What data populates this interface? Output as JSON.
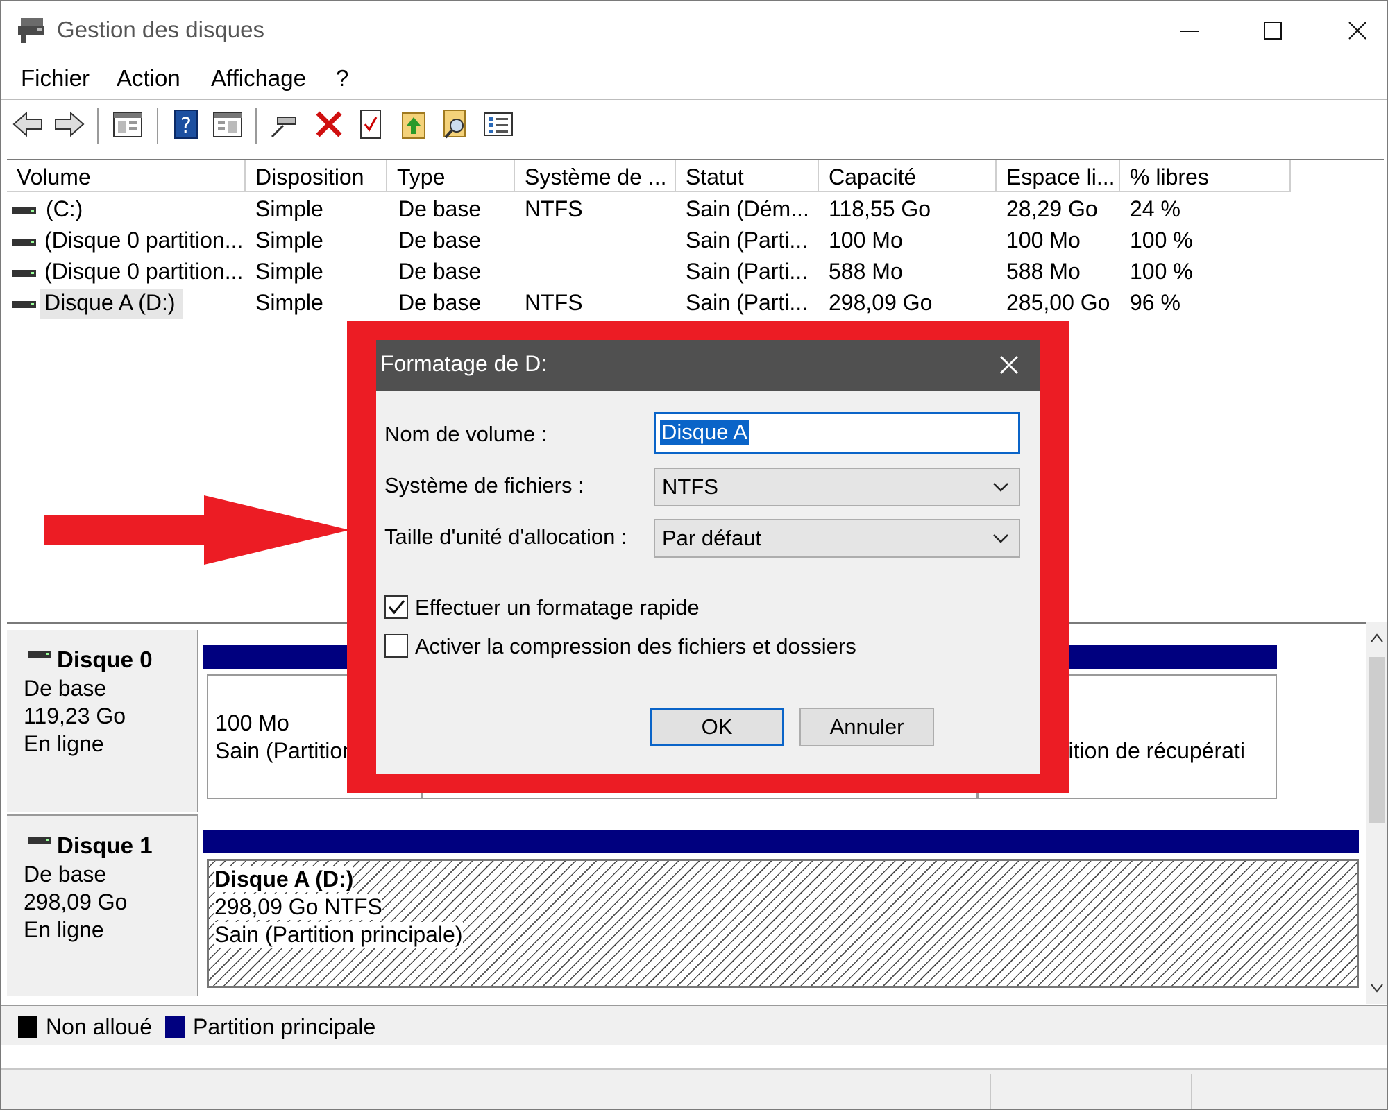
{
  "window": {
    "title": "Gestion des disques"
  },
  "menu": [
    "Fichier",
    "Action",
    "Affichage",
    "?"
  ],
  "table": {
    "columns": [
      "Volume",
      "Disposition",
      "Type",
      "Système de ...",
      "Statut",
      "Capacité",
      "Espace li...",
      "% libres"
    ],
    "rows": [
      [
        "(C:)",
        "Simple",
        "De base",
        "NTFS",
        "Sain (Dém...",
        "118,55 Go",
        "28,29 Go",
        "24 %"
      ],
      [
        "(Disque 0 partition...",
        "Simple",
        "De base",
        "",
        "Sain (Parti...",
        "100 Mo",
        "100 Mo",
        "100 %"
      ],
      [
        "(Disque 0 partition...",
        "Simple",
        "De base",
        "",
        "Sain (Parti...",
        "588 Mo",
        "588 Mo",
        "100 %"
      ],
      [
        "Disque A (D:)",
        "Simple",
        "De base",
        "NTFS",
        "Sain (Parti...",
        "298,09 Go",
        "285,00 Go",
        "96 %"
      ]
    ]
  },
  "disks": [
    {
      "name": "Disque 0",
      "type": "De base",
      "size": "119,23 Go",
      "status": "En ligne",
      "partitions": [
        {
          "line1": "100 Mo",
          "line2": "Sain (Partition"
        },
        {
          "line1": "",
          "line2": "rtition de récupérati"
        }
      ]
    },
    {
      "name": "Disque 1",
      "type": "De base",
      "size": "298,09 Go",
      "status": "En ligne",
      "partitions": [
        {
          "name": "Disque A  (D:)",
          "line1": "298,09 Go NTFS",
          "line2": "Sain (Partition principale)"
        }
      ]
    }
  ],
  "legend": [
    {
      "label": "Non alloué",
      "color": "#000000"
    },
    {
      "label": "Partition principale",
      "color": "#00007f"
    }
  ],
  "dialog": {
    "title": "Formatage de D:",
    "volume_label": "Nom de volume :",
    "volume_value": "Disque A",
    "fs_label": "Système de fichiers :",
    "fs_value": "NTFS",
    "alloc_label": "Taille d'unité d'allocation :",
    "alloc_value": "Par défaut",
    "quick_format_label": "Effectuer un formatage rapide",
    "quick_format_checked": true,
    "compression_label": "Activer la compression des fichiers et dossiers",
    "compression_checked": false,
    "ok_label": "OK",
    "cancel_label": "Annuler"
  },
  "colors": {
    "highlight": "#ec1c24",
    "partition_primary": "#00007f",
    "selection": "#0a64c8"
  }
}
